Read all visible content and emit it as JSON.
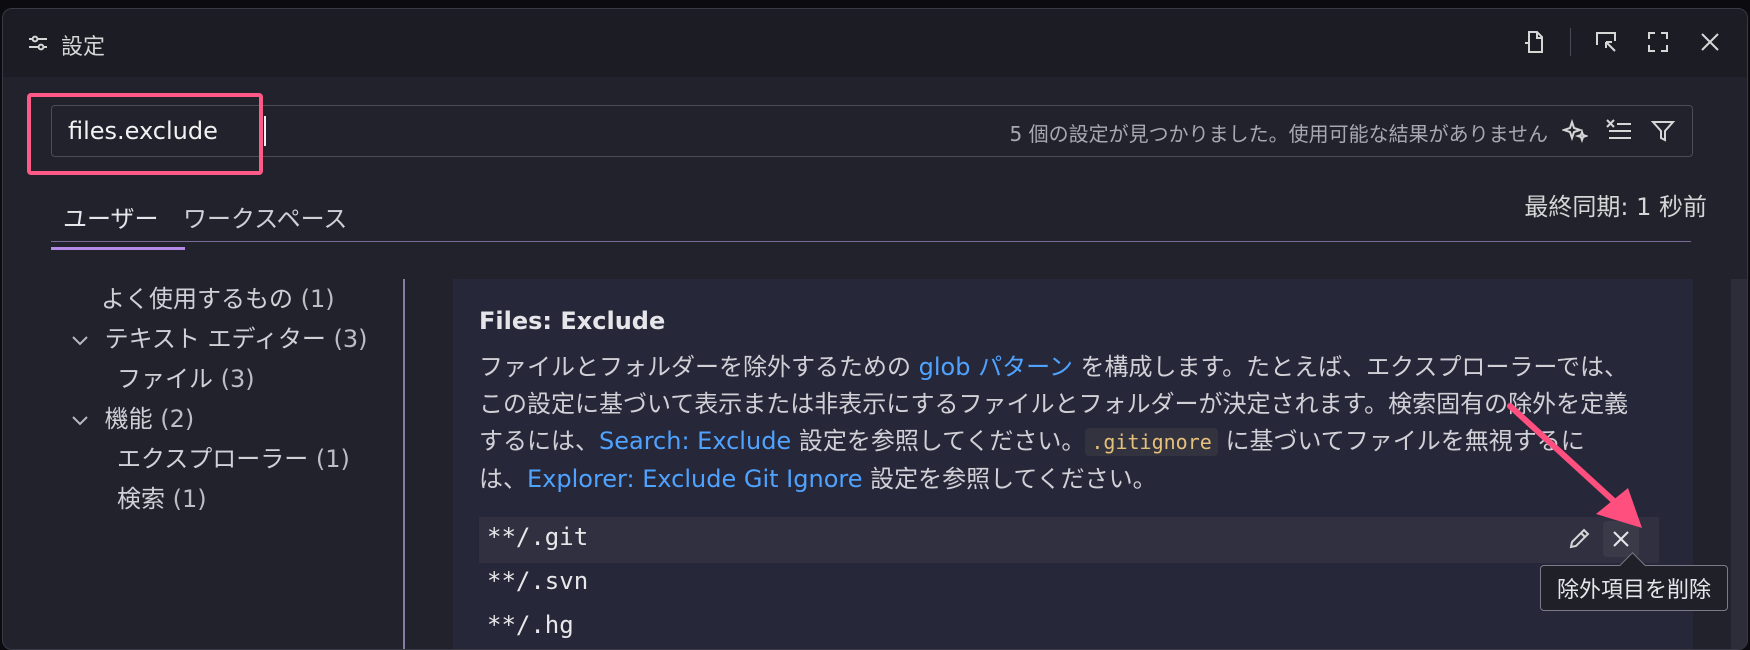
{
  "window": {
    "title": "設定",
    "icons": [
      "settings-icon",
      "open-file-icon",
      "move-window-icon",
      "fullscreen-icon",
      "close-icon"
    ]
  },
  "search": {
    "value": "files.exclude",
    "status": "5 個の設定が見つかりました。使用可能な結果がありません",
    "tools": [
      "ai-sparkle-icon",
      "clear-filter-icon",
      "filter-icon"
    ]
  },
  "tabs": {
    "user": "ユーザー",
    "workspace": "ワークスペース",
    "sync": "最終同期: 1 秒前"
  },
  "tree": [
    {
      "label": "よく使用するもの",
      "count": "(1)",
      "indent": 1,
      "chevron": false
    },
    {
      "label": "テキスト エディター",
      "count": "(3)",
      "indent": 0,
      "chevron": true
    },
    {
      "label": "ファイル",
      "count": "(3)",
      "indent": 2,
      "chevron": false
    },
    {
      "label": "機能",
      "count": "(2)",
      "indent": 0,
      "chevron": true
    },
    {
      "label": "エクスプローラー",
      "count": "(1)",
      "indent": 2,
      "chevron": false
    },
    {
      "label": "検索",
      "count": "(1)",
      "indent": 2,
      "chevron": false
    }
  ],
  "setting": {
    "title": "Files: Exclude",
    "desc_parts": {
      "p1": "ファイルとフォルダーを除外するための ",
      "link1": "glob パターン",
      "p2": " を構成します。たとえば、エクスプローラーでは、この設定に基づいて表示または非表示にするファイルとフォルダーが決定されます。検索固有の除外を定義するには、",
      "link2": "Search: Exclude",
      "p3": " 設定を参照してください。",
      "code": ".gitignore",
      "p4": " に基づいてファイルを無視するには、",
      "link3": "Explorer: Exclude Git Ignore",
      "p5": " 設定を参照してください。"
    },
    "patterns": [
      "**/.git",
      "**/.svn",
      "**/.hg"
    ]
  },
  "tooltip": "除外項目を削除",
  "colors": {
    "accent_highlight": "#ff5a87",
    "link": "#4fa3ff",
    "tab_underline": "#b48ae6"
  }
}
